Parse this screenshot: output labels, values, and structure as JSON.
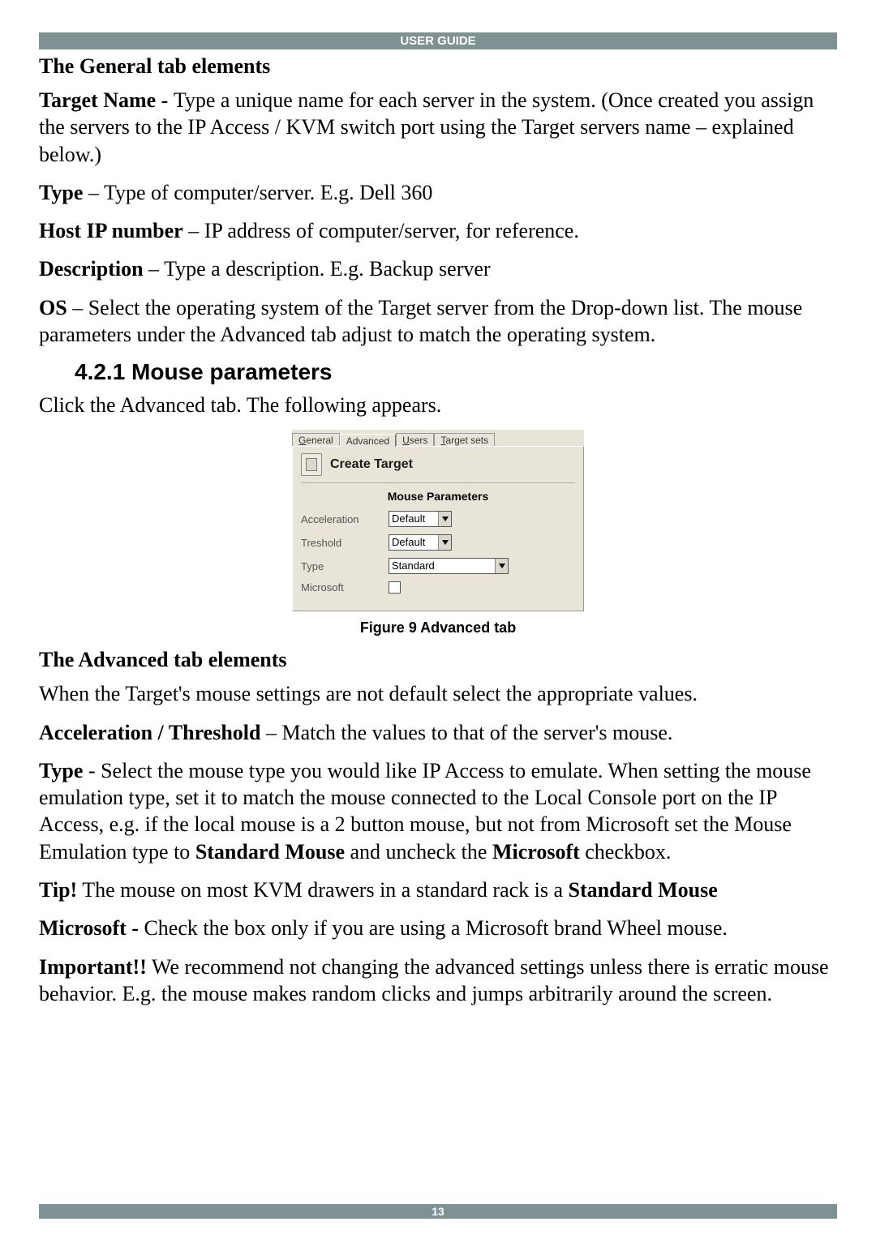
{
  "header": {
    "title": "USER GUIDE"
  },
  "h_general": "The General tab elements",
  "p_target_name": {
    "label": "Target Name - ",
    "text": "Type a unique name for each server in the system. (Once created you assign the servers to the IP Access / KVM switch port using the Target servers name – explained below.)"
  },
  "p_type": {
    "label": "Type",
    "dash": " – ",
    "text": "Type of computer/server. E.g. Dell 360"
  },
  "p_hostip": {
    "label": "Host IP number",
    "dash": " – ",
    "text": "IP address of computer/server, for reference."
  },
  "p_desc": {
    "label": "Description",
    "dash": " – ",
    "text": "Type a description. E.g. Backup server"
  },
  "p_os": {
    "label": "OS",
    "dash": " – ",
    "text": "Select the operating system of the Target server from the Drop-down list. The mouse parameters under the Advanced tab adjust to match the operating system."
  },
  "section_421": "4.2.1 Mouse parameters",
  "p_click_advanced": "Click the Advanced tab. The following appears.",
  "dialog": {
    "tabs": {
      "general": {
        "hotkey": "G",
        "rest": "eneral"
      },
      "advanced": "Advanced",
      "users": {
        "hotkey": "U",
        "rest": "sers"
      },
      "target_sets": {
        "hotkey": "T",
        "rest": "arget sets"
      }
    },
    "create_title": "Create Target",
    "mp_title": "Mouse Parameters",
    "rows": {
      "acceleration": {
        "label": "Acceleration",
        "value": "Default"
      },
      "treshold": {
        "label": "Treshold",
        "value": "Default"
      },
      "type": {
        "label": "Type",
        "value": "Standard"
      },
      "microsoft": {
        "label": "Microsoft",
        "checked": false
      }
    }
  },
  "figure_caption": "Figure 9 Advanced tab",
  "h_advanced": "The Advanced tab elements",
  "p_when": "When the Target's mouse settings are not default select the appropriate values.",
  "p_accel": {
    "label": "Acceleration / Threshold",
    "dash": " – ",
    "text": "Match the values to that of the server's mouse."
  },
  "p_type2": {
    "label": "Type",
    "dash": " - ",
    "pre": "Select the mouse type you would like IP Access to emulate. When setting the mouse emulation type, set it to match the mouse connected to the Local Console port on the IP Access, e.g. if the local mouse is a 2 button mouse, but not from Microsoft set the Mouse Emulation type to ",
    "bold1": "Standard Mouse",
    "mid": " and uncheck the ",
    "bold2": "Microsoft",
    "post": " checkbox."
  },
  "p_tip": {
    "label": "Tip!",
    "text": " The mouse on most KVM drawers in a standard rack is a ",
    "bold": "Standard Mouse"
  },
  "p_ms": {
    "label": "Microsoft - ",
    "text": "Check the box only if you are using a Microsoft brand Wheel mouse."
  },
  "p_important": {
    "label": "Important!!",
    "text": " We recommend not changing the advanced settings unless there is erratic mouse behavior. E.g. the mouse makes random clicks and jumps arbitrarily around the screen."
  },
  "footer": {
    "page": "13"
  }
}
